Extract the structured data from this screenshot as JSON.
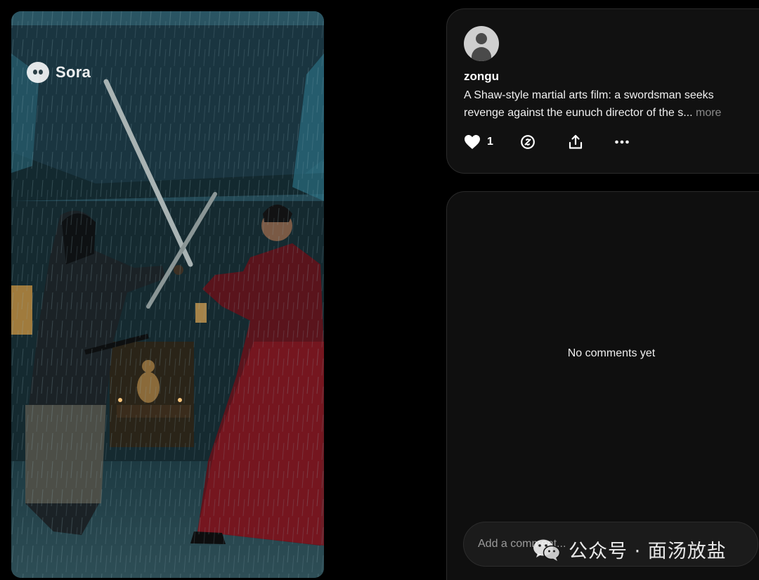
{
  "video": {
    "watermark_text": "Sora",
    "watermark_icon": "sora-logo-icon"
  },
  "post": {
    "username": "zongu",
    "caption": "A Shaw-style martial arts film: a swordsman seeks revenge against the eunuch director of the s...",
    "more_label": "more",
    "like_count": "1",
    "icons": [
      "heart-icon",
      "remix-icon",
      "share-icon",
      "more-icon"
    ]
  },
  "comments": {
    "empty_text": "No comments yet",
    "input_placeholder": "Add a comment..."
  },
  "overlay_watermark": {
    "text": "公众号 · 面汤放盐",
    "icon": "wechat-icon"
  },
  "colors": {
    "background": "#000000",
    "card": "#111111",
    "muted_text": "#8a8a8a"
  }
}
